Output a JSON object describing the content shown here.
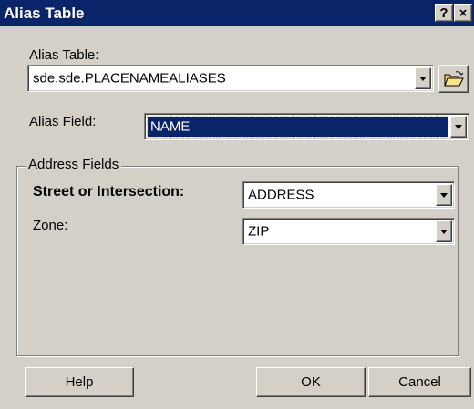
{
  "window": {
    "title": "Alias Table",
    "help_glyph": "?",
    "close_glyph": "×"
  },
  "alias_table": {
    "label": "Alias Table:",
    "value": "sde.sde.PLACENAMEALIASES",
    "browse_icon": "open-folder-icon"
  },
  "alias_field": {
    "label": "Alias Field:",
    "value": "NAME"
  },
  "address_fields": {
    "legend": "Address Fields",
    "street": {
      "label": "Street or Intersection:",
      "value": "ADDRESS"
    },
    "zone": {
      "label": "Zone:",
      "value": "ZIP"
    }
  },
  "buttons": {
    "help": "Help",
    "ok": "OK",
    "cancel": "Cancel"
  },
  "colors": {
    "titlebar": "#0a246a",
    "face": "#d4d0c8",
    "selection": "#0a246a"
  }
}
